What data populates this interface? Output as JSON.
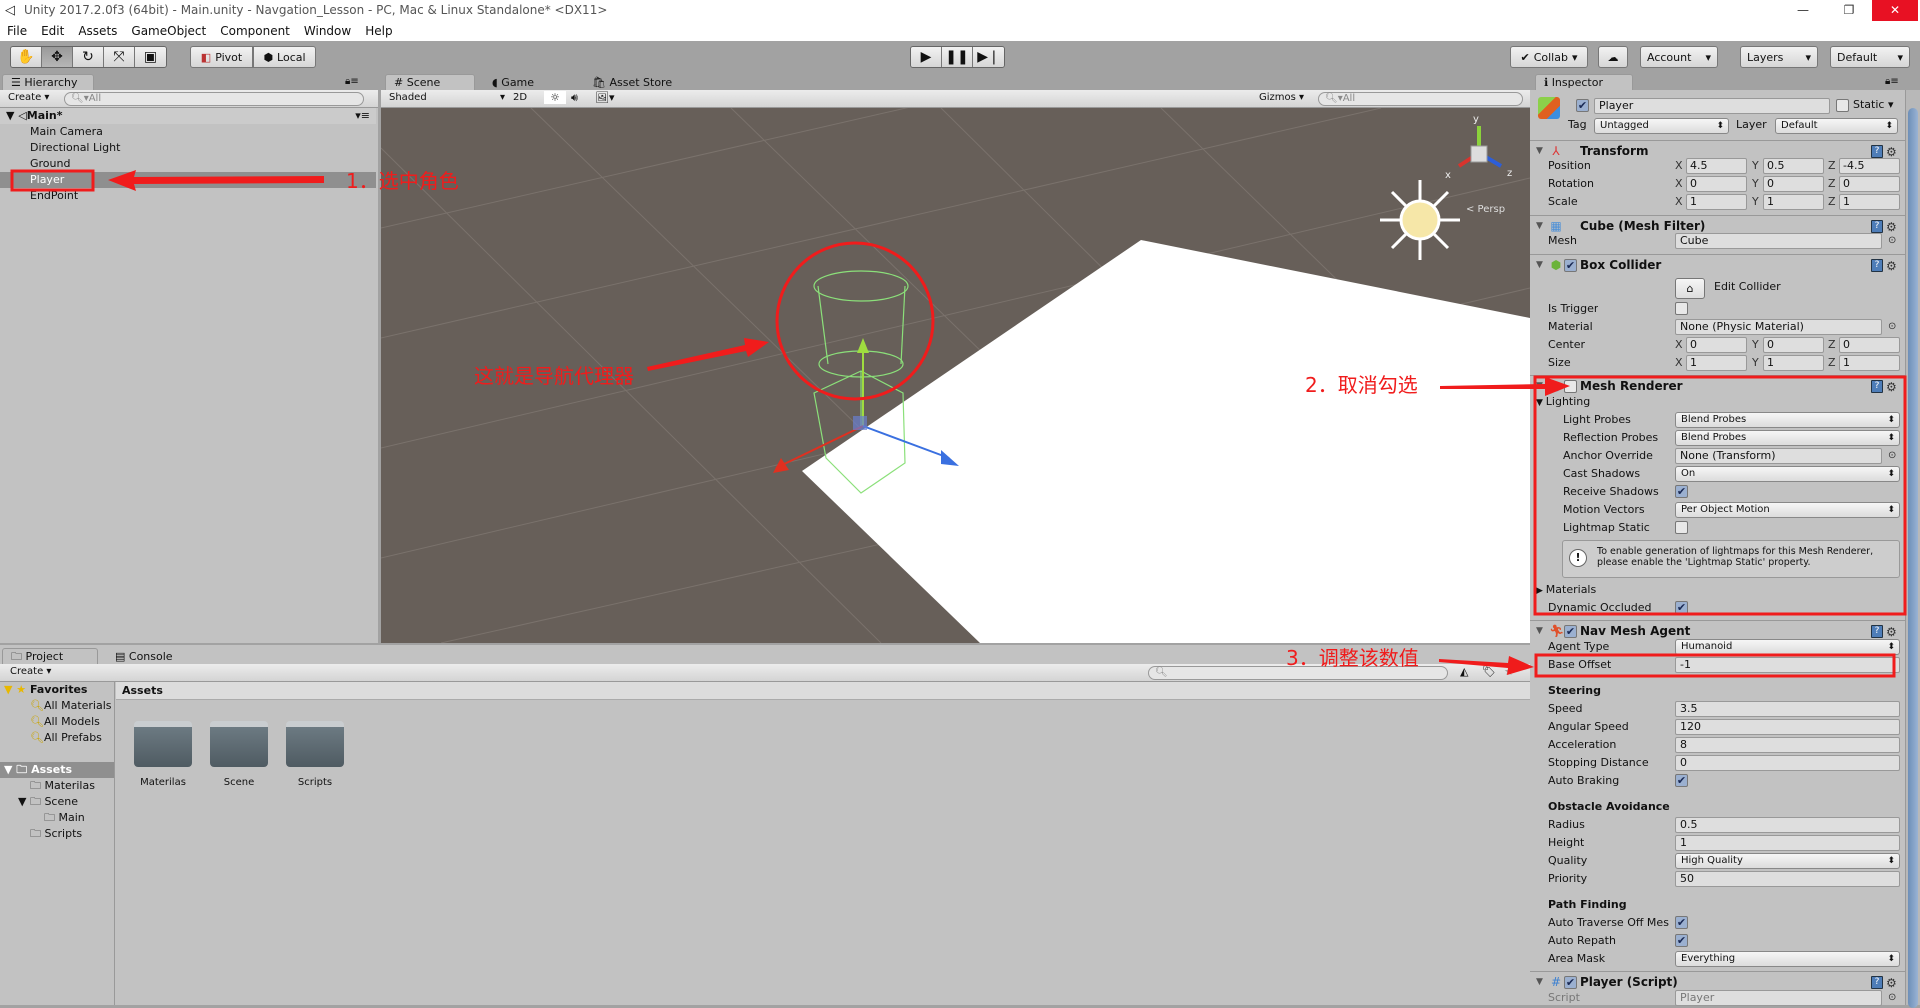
{
  "title": "Unity 2017.2.0f3 (64bit) - Main.unity - Navgation_Lesson - PC, Mac & Linux Standalone* <DX11>",
  "menu": [
    "File",
    "Edit",
    "Assets",
    "GameObject",
    "Component",
    "Window",
    "Help"
  ],
  "toolbar": {
    "pivot": "Pivot",
    "local": "Local",
    "collab": "Collab",
    "account": "Account",
    "layers": "Layers",
    "layout": "Default"
  },
  "hierarchy": {
    "tab": "Hierarchy",
    "create": "Create",
    "search": "All",
    "scene": "Main*",
    "items": [
      "Main Camera",
      "Directional Light",
      "Ground",
      "Player",
      "EndPoint"
    ],
    "selected": "Player"
  },
  "scene": {
    "tabs": [
      "Scene",
      "Game",
      "Asset Store"
    ],
    "shading": "Shaded",
    "mode2d": "2D",
    "gizmos": "Gizmos",
    "search": "All",
    "persp": "< Persp",
    "axis_y": "y",
    "axis_x": "x",
    "axis_z": "z"
  },
  "inspector": {
    "tab": "Inspector",
    "name": "Player",
    "active": true,
    "static_label": "Static",
    "static": false,
    "tag_label": "Tag",
    "tag": "Untagged",
    "layer_label": "Layer",
    "layer": "Default",
    "transform": {
      "title": "Transform",
      "position_label": "Position",
      "rotation_label": "Rotation",
      "scale_label": "Scale",
      "position": [
        "4.5",
        "0.5",
        "-4.5"
      ],
      "rotation": [
        "0",
        "0",
        "0"
      ],
      "scale": [
        "1",
        "1",
        "1"
      ]
    },
    "axes": [
      "X",
      "Y",
      "Z"
    ],
    "mesh_filter": {
      "title": "Cube (Mesh Filter)",
      "mesh_label": "Mesh",
      "mesh": "Cube"
    },
    "box_collider": {
      "title": "Box Collider",
      "enabled": true,
      "edit_collider": "Edit Collider",
      "is_trigger_label": "Is Trigger",
      "is_trigger": false,
      "material_label": "Material",
      "material": "None (Physic Material)",
      "center_label": "Center",
      "center": [
        "0",
        "0",
        "0"
      ],
      "size_label": "Size",
      "size": [
        "1",
        "1",
        "1"
      ]
    },
    "mesh_renderer": {
      "title": "Mesh Renderer",
      "enabled": false,
      "lighting": "Lighting",
      "light_probes_label": "Light Probes",
      "light_probes": "Blend Probes",
      "reflection_probes_label": "Reflection Probes",
      "reflection_probes": "Blend Probes",
      "anchor_override_label": "Anchor Override",
      "anchor_override": "None (Transform)",
      "cast_shadows_label": "Cast Shadows",
      "cast_shadows": "On",
      "receive_shadows_label": "Receive Shadows",
      "receive_shadows": true,
      "motion_vectors_label": "Motion Vectors",
      "motion_vectors": "Per Object Motion",
      "lightmap_static_label": "Lightmap Static",
      "lightmap_static": false,
      "help": "To enable generation of lightmaps for this Mesh Renderer, please enable the 'Lightmap Static' property.",
      "materials": "Materials",
      "dynamic_occluded_label": "Dynamic Occluded",
      "dynamic_occluded": true
    },
    "nav_mesh_agent": {
      "title": "Nav Mesh Agent",
      "enabled": true,
      "agent_type_label": "Agent Type",
      "agent_type": "Humanoid",
      "base_offset_label": "Base Offset",
      "base_offset": "-1",
      "steering": "Steering",
      "speed_label": "Speed",
      "speed": "3.5",
      "angular_speed_label": "Angular Speed",
      "angular_speed": "120",
      "acceleration_label": "Acceleration",
      "acceleration": "8",
      "stopping_distance_label": "Stopping Distance",
      "stopping_distance": "0",
      "auto_braking_label": "Auto Braking",
      "auto_braking": true,
      "obstacle_avoidance": "Obstacle Avoidance",
      "radius_label": "Radius",
      "radius": "0.5",
      "height_label": "Height",
      "height": "1",
      "quality_label": "Quality",
      "quality": "High Quality",
      "priority_label": "Priority",
      "priority": "50",
      "path_finding": "Path Finding",
      "auto_traverse_label": "Auto Traverse Off Mes",
      "auto_traverse": true,
      "auto_repath_label": "Auto Repath",
      "auto_repath": true,
      "area_mask_label": "Area Mask",
      "area_mask": "Everything"
    },
    "player_script": {
      "title": "Player (Script)",
      "enabled": true,
      "script_label": "Script",
      "script": "Player"
    }
  },
  "project": {
    "tabs": [
      "Project",
      "Console"
    ],
    "create": "Create",
    "favorites": "Favorites",
    "favorite_items": [
      "All Materials",
      "All Models",
      "All Prefabs"
    ],
    "assets": "Assets",
    "tree": [
      "Materilas",
      "Scene",
      "Main",
      "Scripts"
    ],
    "breadcrumb": "Assets",
    "folders": [
      "Materilas",
      "Scene",
      "Scripts"
    ]
  },
  "annotations": {
    "step1": "1．选中角色",
    "step2": "2．取消勾选",
    "step3": "3．调整该数值",
    "agent": "这就是导航代理器"
  },
  "colors": {
    "annotation": "#f01c1c",
    "selection": "#8f8f8f",
    "scene_bg": "#675f59",
    "agent_gizmo": "#8be07a"
  }
}
